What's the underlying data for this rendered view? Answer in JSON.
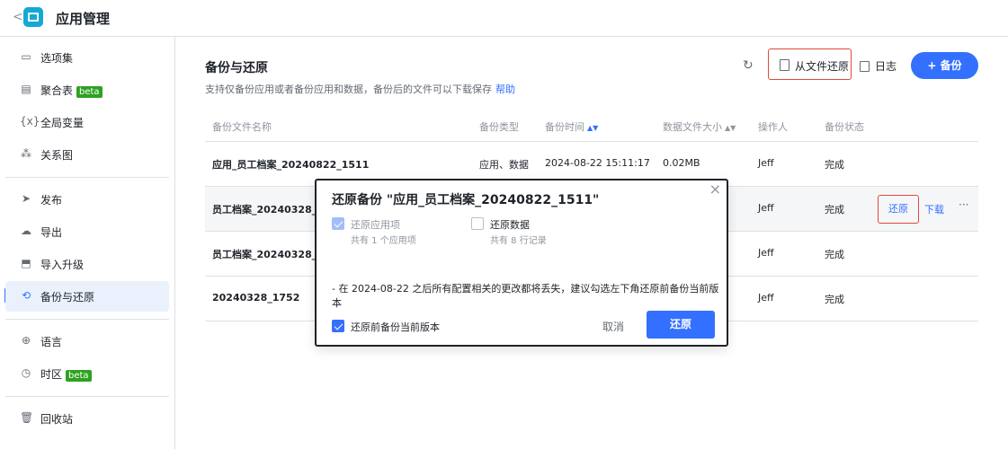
{
  "header": {
    "back_glyph": "<",
    "app_icon": "app-table-icon",
    "title": "应用管理"
  },
  "sidebar": {
    "items": [
      {
        "label": "选项集",
        "icon": "option-set-icon"
      },
      {
        "label": "聚合表",
        "icon": "aggregate-table-icon",
        "badge": "beta"
      },
      {
        "label": "全局变量",
        "icon": "variable-icon"
      },
      {
        "label": "关系图",
        "icon": "relation-graph-icon"
      },
      {
        "label": "发布",
        "icon": "send-icon"
      },
      {
        "label": "导出",
        "icon": "cloud-upload-icon"
      },
      {
        "label": "导入升级",
        "icon": "import-icon"
      },
      {
        "label": "备份与还原",
        "icon": "backup-icon",
        "active": true
      },
      {
        "label": "语言",
        "icon": "globe-icon"
      },
      {
        "label": "时区",
        "icon": "clock-icon",
        "badge": "beta"
      },
      {
        "label": "回收站",
        "icon": "trash-icon"
      }
    ]
  },
  "main": {
    "title": "备份与还原",
    "subtitle": "支持仅备份应用或者备份应用和数据，备份后的文件可以下载保存",
    "help_link": "帮助",
    "toolbar": {
      "refresh_icon": "refresh-icon",
      "restore_from_file": "从文件还原",
      "log": "日志",
      "backup": "+ 备份"
    },
    "table": {
      "columns": [
        "备份文件名称",
        "备份类型",
        "备份时间",
        "数据文件大小",
        "操作人",
        "备份状态"
      ],
      "rows": [
        {
          "name": "应用_员工档案_20240822_1511",
          "type": "应用、数据",
          "time": "2024-08-22 15:11:17",
          "size": "0.02MB",
          "operator": "Jeff",
          "status": "完成"
        },
        {
          "name": "员工档案_20240328_192",
          "type": "",
          "time": "",
          "size": "",
          "operator": "Jeff",
          "status": "完成"
        },
        {
          "name": "员工档案_20240328_180",
          "type": "",
          "time": "",
          "size": "",
          "operator": "Jeff",
          "status": "完成"
        },
        {
          "name": "20240328_1752",
          "type": "",
          "time": "",
          "size": "",
          "operator": "Jeff",
          "status": "完成"
        }
      ],
      "row_actions": {
        "restore": "还原",
        "download": "下载",
        "more": "···"
      }
    }
  },
  "dialog": {
    "title": "还原备份 \"应用_员工档案_20240822_1511\"",
    "close_glyph": "×",
    "options": [
      {
        "label": "还原应用项",
        "sub": "共有 1 个应用项",
        "checked": true,
        "disabled": true
      },
      {
        "label": "还原数据",
        "sub": "共有 8 行记录",
        "checked": false,
        "disabled": false
      }
    ],
    "warning": "- 在 2024-08-22 之后所有配置相关的更改都将丢失，建议勾选左下角还原前备份当前版本",
    "backup_before": {
      "label": "还原前备份当前版本",
      "checked": true
    },
    "cancel": "取消",
    "confirm": "还原"
  },
  "colors": {
    "primary": "#3370ff",
    "highlight_border": "#e0483b",
    "beta_badge": "#2ea121"
  }
}
